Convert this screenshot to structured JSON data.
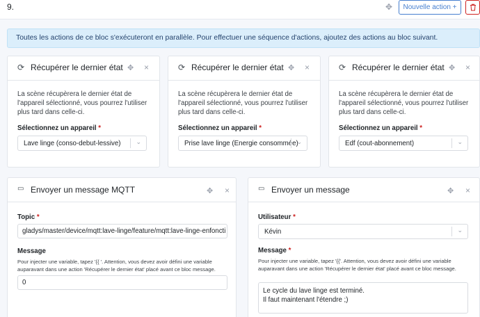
{
  "header": {
    "step_number": "9.",
    "new_action_label": "Nouvelle action +",
    "delete_icon": "trash-icon"
  },
  "alert": {
    "text": "Toutes les actions de ce bloc s'exécuteront en parallèle. Pour effectuer une séquence d'actions, ajoutez des actions au bloc suivant."
  },
  "cards": [
    {
      "title": "Récupérer le dernier état",
      "icon": "refresh-icon",
      "description": "La scène récupèrera le dernier état de l'appareil sélectionné, vous pourrez l'utiliser plus tard dans celle-ci.",
      "device_label": "Sélectionnez un appareil",
      "required_mark": "*",
      "device_value": "Lave linge (conso-debut-lessive)"
    },
    {
      "title": "Récupérer le dernier état",
      "icon": "refresh-icon",
      "description": "La scène récupèrera le dernier état de l'appareil sélectionné, vous pourrez l'utiliser plus tard dans celle-ci.",
      "device_label": "Sélectionnez un appareil",
      "required_mark": "*",
      "device_value": "Prise lave linge (Energie consommée)"
    },
    {
      "title": "Récupérer le dernier état",
      "icon": "refresh-icon",
      "description": "La scène récupèrera le dernier état de l'appareil sélectionné, vous pourrez l'utiliser plus tard dans celle-ci.",
      "device_label": "Sélectionnez un appareil",
      "required_mark": "*",
      "device_value": "Edf (cout-abonnement)"
    }
  ],
  "mqtt": {
    "title": "Envoyer un message MQTT",
    "icon": "message-icon",
    "topic_label": "Topic",
    "required_mark": "*",
    "topic_value": "gladys/master/device/mqtt:lave-linge/feature/mqtt:lave-linge-enfoncti",
    "message_label": "Message",
    "help": "Pour injecter une variable, tapez '{{ '. Attention, vous devez avoir défini une variable auparavant dans une action 'Récupérer le dernier état' placé avant ce bloc message.",
    "message_value": "0"
  },
  "message": {
    "title": "Envoyer un message",
    "icon": "message-icon",
    "user_label": "Utilisateur",
    "required_mark": "*",
    "user_value": "Kévin",
    "message_label": "Message",
    "help": "Pour injecter une variable, tapez '{{'. Attention, vous devez avoir défini une variable auparavant dans une action 'Récupérer le dernier état' placé avant ce bloc message.",
    "message_line1": "Le cycle du lave linge est terminé.",
    "message_line2": "Il faut maintenant l'étendre ;)"
  },
  "colors": {
    "primary": "#467fcf",
    "danger": "#cd201f",
    "alert_bg": "#dbeefb"
  }
}
